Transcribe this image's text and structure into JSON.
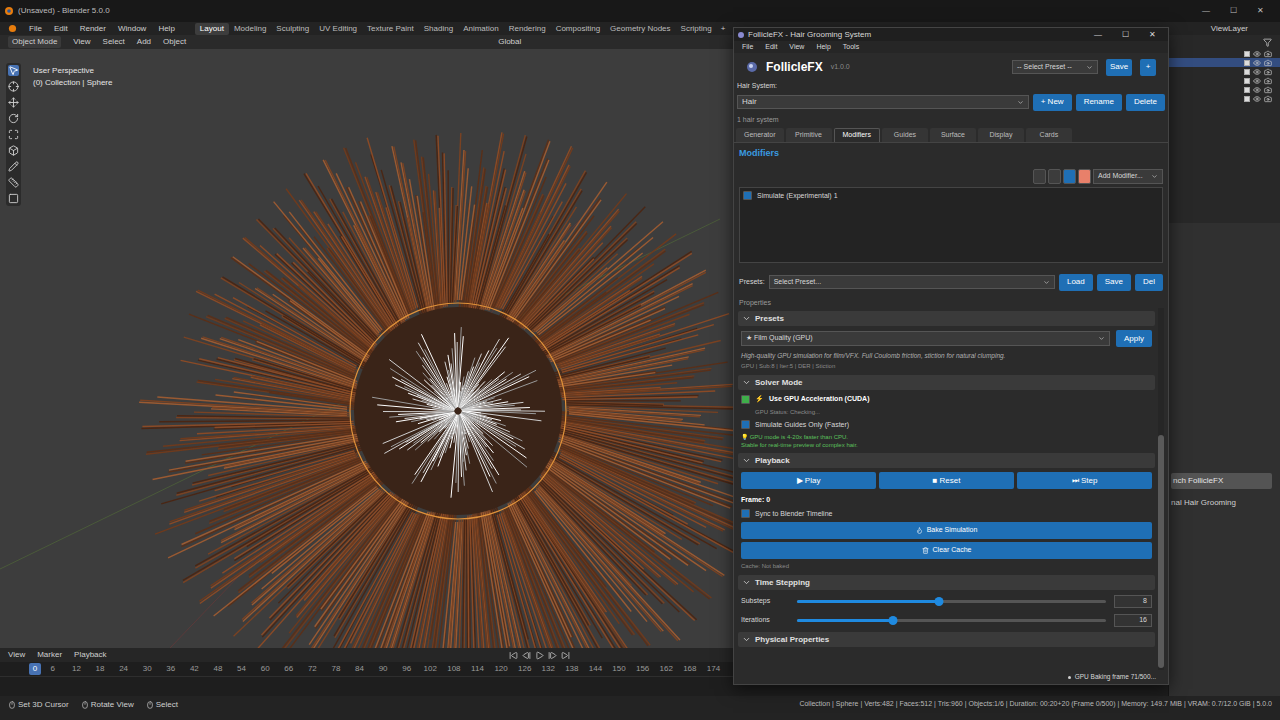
{
  "blender": {
    "title": "(Unsaved) - Blender 5.0.0",
    "window_controls": [
      "—",
      "☐",
      "✕"
    ],
    "menus": [
      "File",
      "Edit",
      "Render",
      "Window",
      "Help"
    ],
    "workspaces": [
      {
        "label": "Layout",
        "selected": true
      },
      {
        "label": "Modeling",
        "selected": false
      },
      {
        "label": "Sculpting",
        "selected": false
      },
      {
        "label": "UV Editing",
        "selected": false
      },
      {
        "label": "Texture Paint",
        "selected": false
      },
      {
        "label": "Shading",
        "selected": false
      },
      {
        "label": "Animation",
        "selected": false
      },
      {
        "label": "Rendering",
        "selected": false
      },
      {
        "label": "Compositing",
        "selected": false
      },
      {
        "label": "Geometry Nodes",
        "selected": false
      },
      {
        "label": "Scripting",
        "selected": false
      }
    ],
    "add_workspace": "+",
    "view_layer": "ViewLayer",
    "viewport_header": {
      "mode": "Object Mode",
      "menus": [
        "View",
        "Select",
        "Add",
        "Object"
      ],
      "orientation": "Global"
    },
    "viewport_overlay": [
      "User Perspective",
      "(0) Collection | Sphere"
    ],
    "outliner_rows": [
      {
        "selected": false
      },
      {
        "selected": true
      },
      {
        "selected": false
      },
      {
        "selected": false
      },
      {
        "selected": false
      },
      {
        "selected": false
      }
    ],
    "properties_buttons": [
      "nch FollicleFX"
    ],
    "properties_labels": [
      "nal Hair Grooming"
    ],
    "timeline": {
      "menus": [
        "View",
        "Marker",
        "Playback"
      ],
      "current_frame": "0",
      "ticks": [
        "6",
        "12",
        "18",
        "24",
        "30",
        "36",
        "42",
        "48",
        "54",
        "60",
        "66",
        "72",
        "78",
        "84",
        "90",
        "96",
        "102",
        "108",
        "114",
        "120",
        "126",
        "132",
        "138",
        "144",
        "150",
        "156",
        "162",
        "168",
        "174"
      ]
    },
    "status_bar": {
      "hints": [
        "Set 3D Cursor",
        "Rotate View",
        "Select"
      ],
      "stats": "Collection | Sphere | Verts:482 | Faces:512 | Tris:960 | Objects:1/6 | Duration: 00:20+20 (Frame 0/500) | Memory: 149.7 MiB | VRAM: 0.7/12.0 GiB | 5.0.0"
    }
  },
  "plugin": {
    "title": "FollicleFX - Hair Grooming System",
    "window_controls": [
      "—",
      "☐",
      "✕"
    ],
    "menus": [
      "File",
      "Edit",
      "View",
      "Help",
      "Tools"
    ],
    "brand": "FollicleFX",
    "version": "v1.0.0",
    "preset_select": "-- Select Preset --",
    "save": "Save",
    "add": "+",
    "hair_system_label": "Hair System:",
    "hair_system": "Hair",
    "system_buttons": [
      "+ New",
      "Rename",
      "Delete"
    ],
    "system_count": "1 hair system",
    "tabs": [
      {
        "label": "Generator",
        "selected": false
      },
      {
        "label": "Primitive",
        "selected": false
      },
      {
        "label": "Modifiers",
        "selected": true
      },
      {
        "label": "Guides",
        "selected": false
      },
      {
        "label": "Surface",
        "selected": false
      },
      {
        "label": "Display",
        "selected": false
      },
      {
        "label": "Cards",
        "selected": false
      }
    ],
    "section_title": "Modifiers",
    "modifier_toolbar": [
      {
        "color": "#3c3c3c"
      },
      {
        "color": "#3c3c3c"
      },
      {
        "color": "#1f6fb5"
      },
      {
        "color": "#e8806a"
      }
    ],
    "add_modifier": "Add Modifier...",
    "modifiers": [
      {
        "label": "Simulate (Experimental) 1",
        "checked": true
      }
    ],
    "presets_row": {
      "label": "Presets:",
      "select": "Select Preset...",
      "buttons": [
        "Load",
        "Save",
        "Del"
      ]
    },
    "properties_label": "Properties",
    "presets_section": {
      "title": "Presets",
      "expanded": true,
      "select": "★ Film Quality (GPU)",
      "apply": "Apply",
      "description": "High-quality GPU simulation for film/VFX. Full Coulomb friction, stiction for natural clumping.",
      "tags": "GPU | Sub:8 | Iter:5 | DER | Stiction"
    },
    "solver_section": {
      "title": "Solver Mode",
      "expanded": true,
      "gpu": {
        "icon": "⚡",
        "label": "Use GPU Acceleration (CUDA)",
        "checked": true,
        "color": "#3fae4a"
      },
      "gpu_status": "GPU Status: Checking...",
      "guides_only": {
        "label": "Simulate Guides Only (Faster)",
        "checked": true,
        "color": "#1f6fb5"
      },
      "tips": [
        "💡 GPU mode is 4-20x faster than CPU.",
        "Stable for real-time preview of complex hair."
      ]
    },
    "playback_section": {
      "title": "Playback",
      "expanded": true,
      "buttons": [
        "▶ Play",
        "■ Reset",
        "⏭ Step"
      ],
      "frame": "Frame: 0",
      "sync": {
        "label": "Sync to Blender Timeline",
        "checked": true,
        "color": "#1f6fb5"
      },
      "bake": "Bake Simulation",
      "clear": "Clear Cache",
      "cache": "Cache: Not baked"
    },
    "time_section": {
      "title": "Time Stepping",
      "expanded": true,
      "sliders": [
        {
          "label": "Substeps",
          "level": 0.46,
          "value": "8"
        },
        {
          "label": "Iterations",
          "level": 0.31,
          "value": "16"
        }
      ]
    },
    "physical_section": {
      "title": "Physical Properties",
      "expanded": true
    },
    "status": "GPU Baking frame 71/500..."
  }
}
